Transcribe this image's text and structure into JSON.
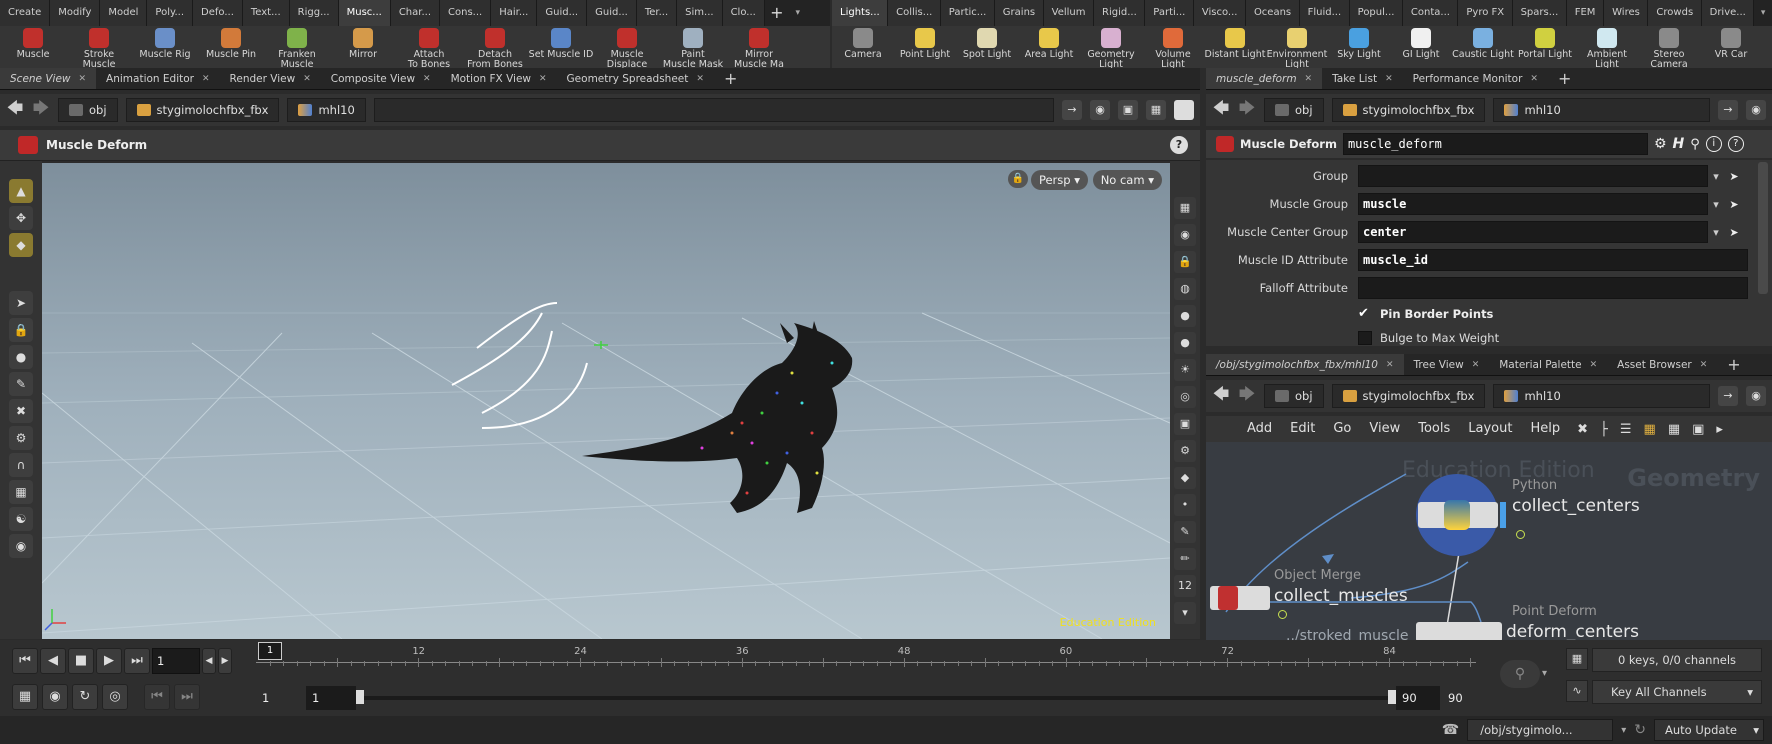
{
  "shelf_tabs_left": [
    "Create",
    "Modify",
    "Model",
    "Poly...",
    "Defo...",
    "Text...",
    "Rigg...",
    "Musc...",
    "Char...",
    "Cons...",
    "Hair...",
    "Guid...",
    "Guid...",
    "Ter...",
    "Sim...",
    "Clo..."
  ],
  "shelf_tabs_right": [
    "Lights...",
    "Collis...",
    "Partic...",
    "Grains",
    "Vellum",
    "Rigid...",
    "Parti...",
    "Visco...",
    "Oceans",
    "Fluid...",
    "Popul...",
    "Conta...",
    "Pyro FX",
    "Spars...",
    "FEM",
    "Wires",
    "Crowds",
    "Drive..."
  ],
  "shelf_tools_left": [
    {
      "label": "Muscle",
      "color": "#c0302c"
    },
    {
      "label": "Stroke Muscle",
      "color": "#c0302c"
    },
    {
      "label": "Muscle Rig",
      "color": "#6a8fc8"
    },
    {
      "label": "Muscle Pin",
      "color": "#d27a3a"
    },
    {
      "label": "Franken\nMuscle",
      "color": "#7fb24a"
    },
    {
      "label": "Mirror",
      "color": "#d59a4a"
    },
    {
      "label": "Attach\nTo Bones",
      "color": "#c0302c"
    },
    {
      "label": "Detach\nFrom Bones",
      "color": "#c0302c"
    },
    {
      "label": "Set Muscle ID",
      "color": "#5a86c8"
    },
    {
      "label": "Muscle\nDisplace",
      "color": "#c0302c"
    },
    {
      "label": "Paint\nMuscle Mask",
      "color": "#9fb0c0"
    },
    {
      "label": "Mirror\nMuscle Ma",
      "color": "#c0302c"
    }
  ],
  "shelf_tools_right": [
    {
      "label": "Camera",
      "color": "#8a8a8a"
    },
    {
      "label": "Point Light",
      "color": "#e8c84a"
    },
    {
      "label": "Spot Light",
      "color": "#e0d8b0"
    },
    {
      "label": "Area Light",
      "color": "#e8c84a"
    },
    {
      "label": "Geometry\nLight",
      "color": "#d8b0d0"
    },
    {
      "label": "Volume Light",
      "color": "#e06a3a"
    },
    {
      "label": "Distant Light",
      "color": "#e8c84a"
    },
    {
      "label": "Environment\nLight",
      "color": "#e8d070"
    },
    {
      "label": "Sky Light",
      "color": "#4aa0e0"
    },
    {
      "label": "GI Light",
      "color": "#f0f0f0"
    },
    {
      "label": "Caustic Light",
      "color": "#7ab0e0"
    },
    {
      "label": "Portal Light",
      "color": "#d0d040"
    },
    {
      "label": "Ambient Light",
      "color": "#d0e8f0"
    },
    {
      "label": "Stereo\nCamera",
      "color": "#8a8a8a"
    },
    {
      "label": "VR Car",
      "color": "#8a8a8a"
    }
  ],
  "viewer_tabs": [
    "Scene View",
    "Animation Editor",
    "Render View",
    "Composite View",
    "Motion FX View",
    "Geometry Spreadsheet"
  ],
  "path": {
    "root": "obj",
    "object": "stygimolochfbx_fbx",
    "node": "mhl10"
  },
  "viewport": {
    "node_title": "Muscle Deform",
    "camera_persp": "Persp",
    "camera_nocam": "No cam",
    "watermark": "Education Edition"
  },
  "parm_tabs": [
    "muscle_deform",
    "Take List",
    "Performance Monitor"
  ],
  "parms": {
    "node_type": "Muscle Deform",
    "node_name": "muscle_deform",
    "group_label": "Group",
    "group_value": "",
    "muscle_group_label": "Muscle Group",
    "muscle_group_value": "muscle",
    "center_group_label": "Muscle Center Group",
    "center_group_value": "center",
    "id_attr_label": "Muscle ID Attribute",
    "id_attr_value": "muscle_id",
    "falloff_label": "Falloff Attribute",
    "falloff_value": "",
    "pin_border": "Pin Border Points",
    "bulge": "Bulge to Max Weight"
  },
  "network_tabs": [
    "/obj/stygimolochfbx_fbx/mhl10",
    "Tree View",
    "Material Palette",
    "Asset Browser"
  ],
  "network_menu": [
    "Add",
    "Edit",
    "Go",
    "View",
    "Tools",
    "Layout",
    "Help"
  ],
  "network": {
    "edition": "Education Edition",
    "context": "Geometry",
    "nodes": [
      {
        "type": "Python",
        "name": "collect_centers"
      },
      {
        "type": "Object Merge",
        "name": "collect_muscles"
      },
      {
        "type": "Point Deform",
        "name": "deform_centers"
      }
    ],
    "merge_path": "../stroked_muscle"
  },
  "timeline": {
    "frame": "1",
    "start": "1",
    "start2": "1",
    "end": "90",
    "end2": "90",
    "ticks": [
      "12",
      "24",
      "36",
      "48",
      "60",
      "72",
      "84"
    ],
    "marker": "1"
  },
  "keys": {
    "channels": "0 keys, 0/0 channels",
    "key_all": "Key All Channels"
  },
  "status": {
    "path": "/obj/stygimolo...",
    "update": "Auto Update"
  }
}
